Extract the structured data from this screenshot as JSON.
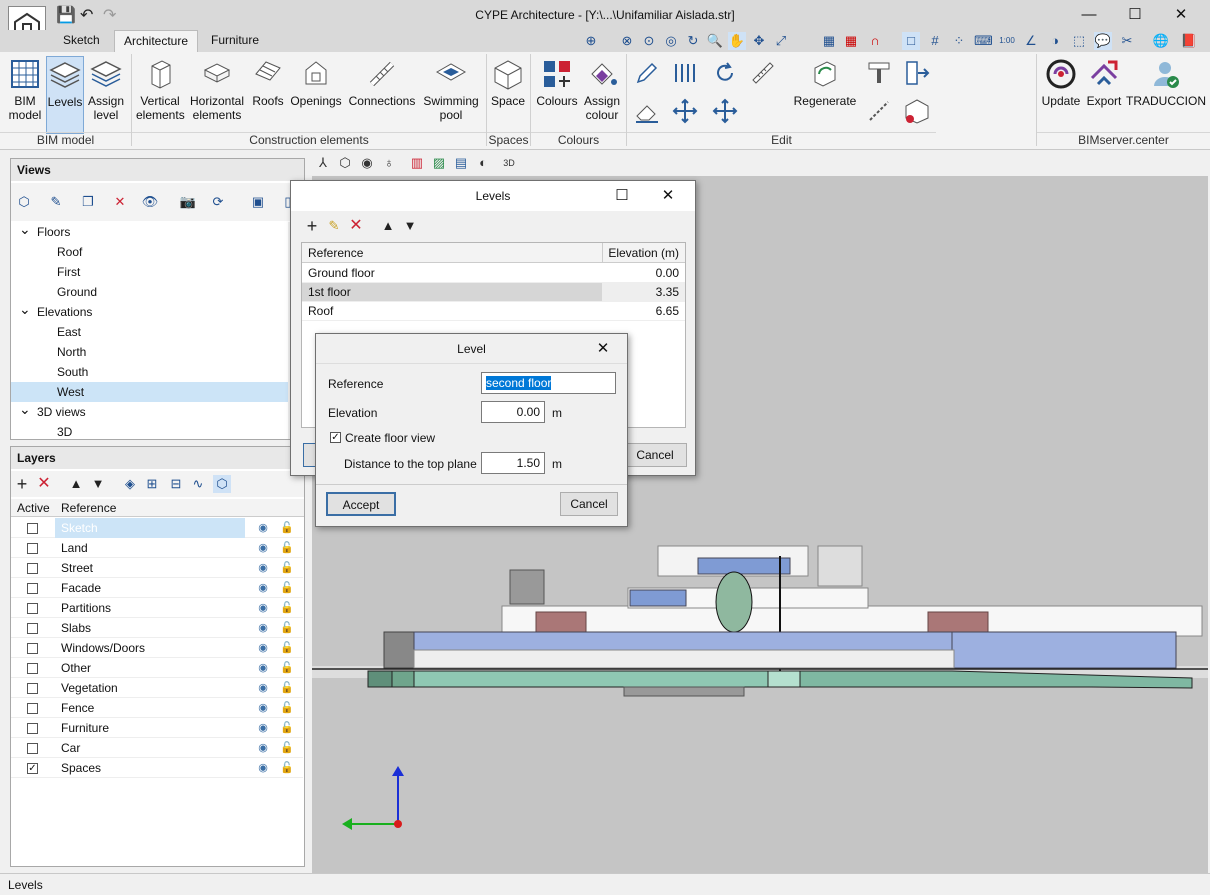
{
  "window": {
    "title": "CYPE Architecture - [Y:\\...\\Unifamiliar Aislada.str]",
    "minimize": "—",
    "maximize": "☐",
    "close": "✕"
  },
  "quick_access": [
    "save-icon",
    "undo-icon",
    "redo-icon"
  ],
  "tabs": [
    {
      "label": "Sketch"
    },
    {
      "label": "Architecture"
    },
    {
      "label": "Furniture"
    }
  ],
  "ribbon": {
    "bim_model": {
      "label": "BIM\nmodel"
    },
    "levels": {
      "label": "Levels"
    },
    "assign_level": {
      "label": "Assign\nlevel"
    },
    "vertical": {
      "label": "Vertical\nelements"
    },
    "horizontal": {
      "label": "Horizontal\nelements"
    },
    "roofs": {
      "label": "Roofs"
    },
    "openings": {
      "label": "Openings"
    },
    "connections": {
      "label": "Connections"
    },
    "pool": {
      "label": "Swimming\npool"
    },
    "space": {
      "label": "Space"
    },
    "colours": {
      "label": "Colours"
    },
    "assign_colour": {
      "label": "Assign\ncolour"
    },
    "regenerate": {
      "label": "Regenerate"
    },
    "update": {
      "label": "Update"
    },
    "export": {
      "label": "Export"
    },
    "traduccion": {
      "label": "TRADUCCION"
    },
    "groups": {
      "bim_model": "BIM model",
      "construction": "Construction elements",
      "spaces": "Spaces",
      "colours": "Colours",
      "edit": "Edit",
      "bimserver": "BIMserver.center"
    }
  },
  "views_panel": {
    "title": "Views",
    "tree": [
      {
        "label": "Floors",
        "type": "group"
      },
      {
        "label": "Roof",
        "type": "item"
      },
      {
        "label": "First",
        "type": "item"
      },
      {
        "label": "Ground",
        "type": "item"
      },
      {
        "label": "Elevations",
        "type": "group"
      },
      {
        "label": "East",
        "type": "item"
      },
      {
        "label": "North",
        "type": "item"
      },
      {
        "label": "South",
        "type": "item"
      },
      {
        "label": "West",
        "type": "item",
        "selected": true
      },
      {
        "label": "3D views",
        "type": "group"
      },
      {
        "label": "3D",
        "type": "item"
      }
    ]
  },
  "layers_panel": {
    "title": "Layers",
    "col_active": "Active",
    "col_reference": "Reference",
    "rows": [
      {
        "name": "Sketch",
        "active": false,
        "selected": true
      },
      {
        "name": "Land",
        "active": false
      },
      {
        "name": "Street",
        "active": false
      },
      {
        "name": "Facade",
        "active": false
      },
      {
        "name": "Partitions",
        "active": false
      },
      {
        "name": "Slabs",
        "active": false
      },
      {
        "name": "Windows/Doors",
        "active": false
      },
      {
        "name": "Other",
        "active": false
      },
      {
        "name": "Vegetation",
        "active": false
      },
      {
        "name": "Fence",
        "active": false
      },
      {
        "name": "Furniture",
        "active": false
      },
      {
        "name": "Car",
        "active": false
      },
      {
        "name": "Spaces",
        "active": true
      }
    ]
  },
  "levels_dialog": {
    "title": "Levels",
    "col_reference": "Reference",
    "col_elevation": "Elevation (m)",
    "rows": [
      {
        "reference": "Ground floor",
        "elevation": "0.00"
      },
      {
        "reference": "1st floor",
        "elevation": "3.35",
        "selected": true
      },
      {
        "reference": "Roof",
        "elevation": "6.65"
      }
    ],
    "cancel": "Cancel"
  },
  "level_dialog": {
    "title": "Level",
    "reference_label": "Reference",
    "reference_value": "second floor",
    "elevation_label": "Elevation",
    "elevation_value": "0.00",
    "elevation_unit": "m",
    "create_floor_view_label": "Create floor view",
    "create_floor_view_checked": true,
    "distance_label": "Distance to the top plane",
    "distance_value": "1.50",
    "distance_unit": "m",
    "accept": "Accept",
    "cancel": "Cancel"
  },
  "status": {
    "text": "Levels"
  },
  "colors": {
    "accent": "#cfe2f6",
    "selected_row": "#cce4f7",
    "dialog_selected": "#d6d6d6",
    "viewport": "#c5c5c5"
  }
}
